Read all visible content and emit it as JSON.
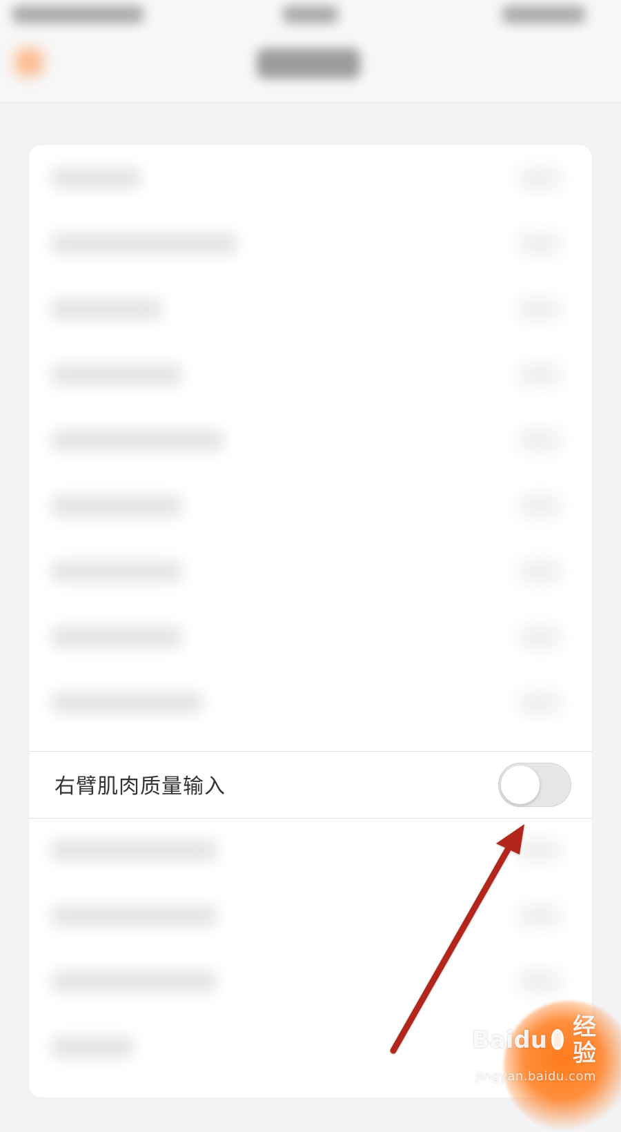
{
  "focused_setting": {
    "label": "右臂肌肉质量输入",
    "toggle": {
      "state": "off"
    }
  },
  "watermark": {
    "brand": "Baidu",
    "suffix": "经验",
    "domain": "jingyan.baidu.com"
  },
  "colors": {
    "background": "#f3f3f6",
    "card": "#ffffff",
    "text": "#333333",
    "toggle_off_track": "#e6e6e8",
    "toggle_knob": "#ffffff",
    "annotation_arrow": "#b3261e",
    "accent_orange": "#ff7a1a"
  },
  "icons": {
    "back": "chevron-left-icon",
    "annotation": "arrow-icon",
    "brand": "baidu-paw-icon"
  }
}
